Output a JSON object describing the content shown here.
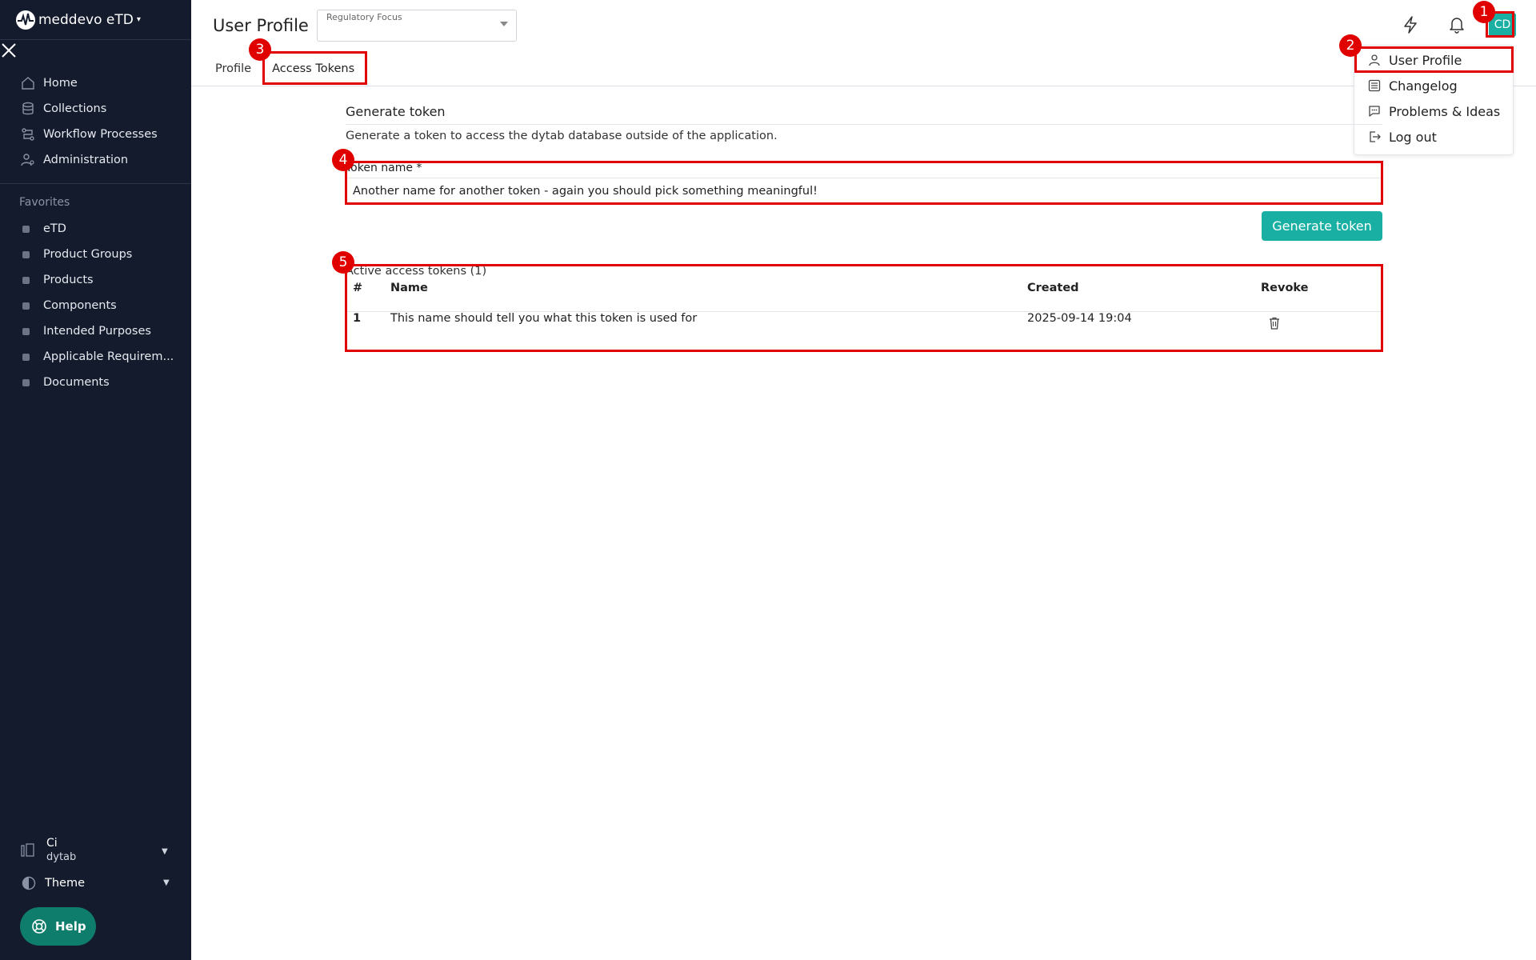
{
  "sidebar": {
    "app_name": "meddevo eTD",
    "nav": [
      {
        "label": "Home",
        "icon": "home-icon"
      },
      {
        "label": "Collections",
        "icon": "database-icon"
      },
      {
        "label": "Workflow Processes",
        "icon": "workflow-icon"
      },
      {
        "label": "Administration",
        "icon": "user-settings-icon"
      }
    ],
    "favorites_title": "Favorites",
    "favorites": [
      "eTD",
      "Product Groups",
      "Products",
      "Components",
      "Intended Purposes",
      "Applicable Requirem...",
      "Documents"
    ],
    "org": {
      "line1": "Ci",
      "line2": "dytab"
    },
    "theme_label": "Theme",
    "help_label": "Help"
  },
  "header": {
    "title": "User Profile",
    "regulatory_focus_label": "Regulatory Focus",
    "tabs": [
      {
        "label": "Profile",
        "active": false
      },
      {
        "label": "Access Tokens",
        "active": true
      }
    ],
    "avatar_initials": "CD"
  },
  "user_menu": {
    "items": [
      {
        "label": "User Profile",
        "icon": "user-icon"
      },
      {
        "label": "Changelog",
        "icon": "list-icon"
      },
      {
        "label": "Problems & Ideas",
        "icon": "chat-icon"
      },
      {
        "label": "Log out",
        "icon": "logout-icon"
      }
    ]
  },
  "generate": {
    "title": "Generate token",
    "description": "Generate a token to access the dytab database outside of the application.",
    "field_label": "Token name  *",
    "field_value": "Another name for another token - again you should pick something meaningful!",
    "button_label": "Generate token"
  },
  "tokens_table": {
    "title": "Active access tokens (1)",
    "columns": [
      "#",
      "Name",
      "Created",
      "Revoke"
    ],
    "rows": [
      {
        "index": "1",
        "name": "This name should tell you what this token is used for",
        "created": "2025-09-14 19:04"
      }
    ]
  },
  "annotations": [
    "1",
    "2",
    "3",
    "4",
    "5"
  ],
  "colors": {
    "sidebar_bg": "#141b2d",
    "accent": "#19b0a3",
    "help_bg": "#0f7d6c",
    "annotation": "#e00000"
  }
}
